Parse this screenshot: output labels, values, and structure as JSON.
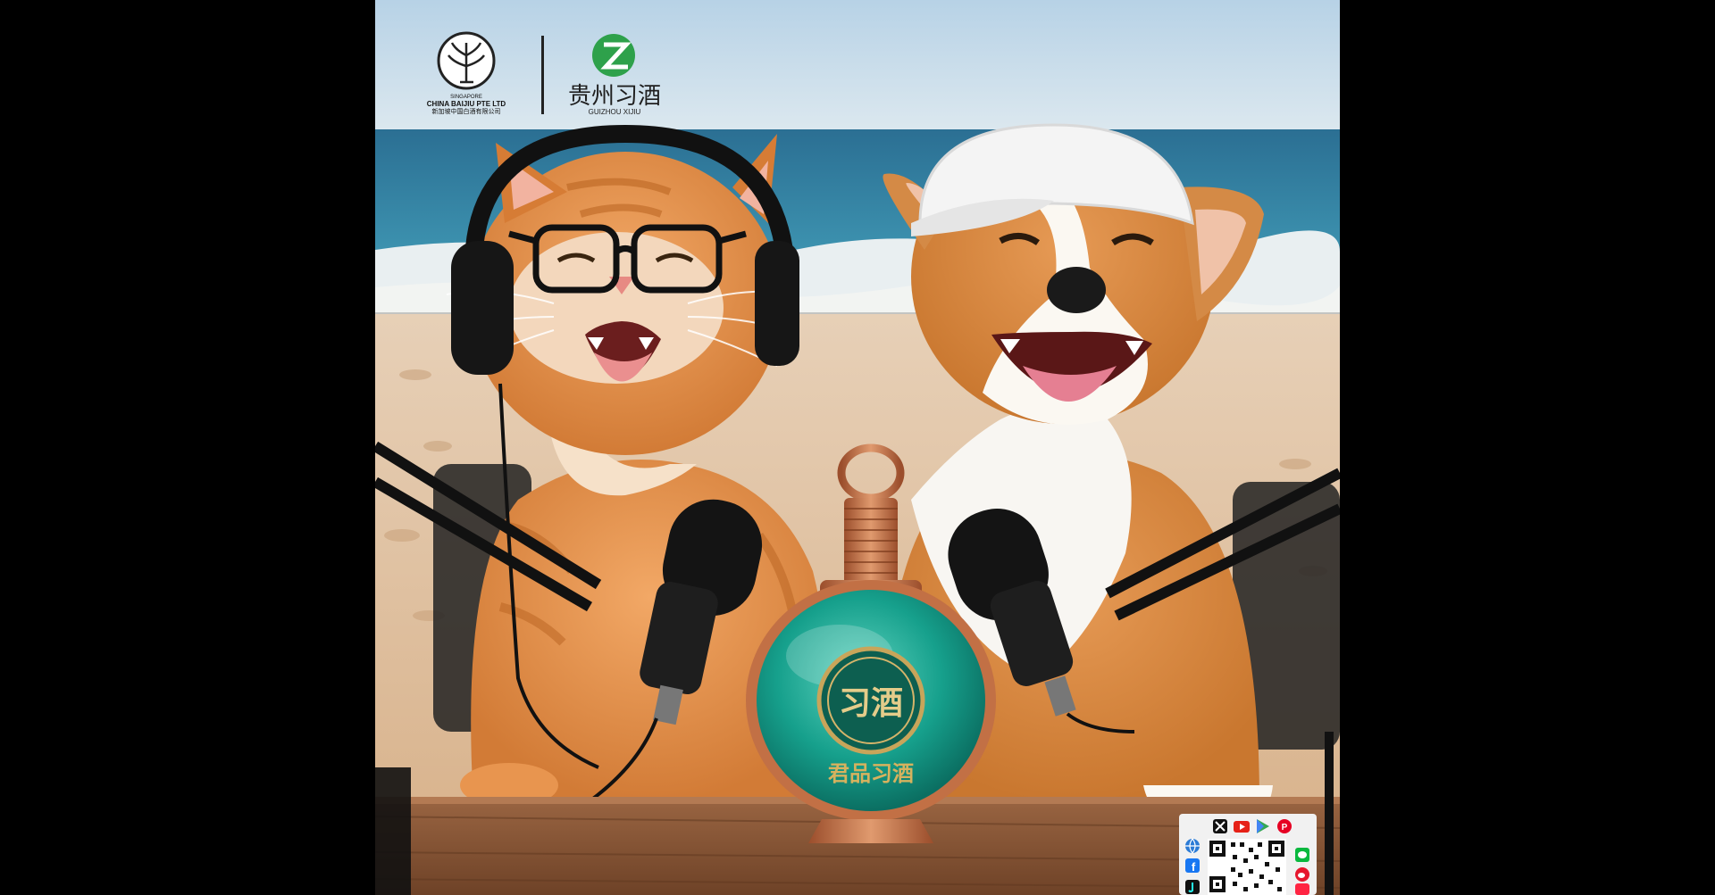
{
  "photo": {
    "subject": "",
    "colors": {
      "letterbox": "#000000",
      "sky_top": "#b9d3e6",
      "sky_bottom": "#d9e6ee",
      "sea": "#2f7fa3",
      "surf": "#e8eef0",
      "sand": "#e9cfb0",
      "table": "#8a5a3a",
      "cat_fur": "#e58f48",
      "dog_fur": "#d98a45",
      "bottle_green": "#1fa894",
      "bottle_copper": "#c9784e",
      "mic_black": "#1a1a1a"
    }
  },
  "logos": {
    "left_brand": {
      "icon": "baijiu-tree-emblem-icon",
      "line1": "SINGAPORE",
      "line2": "CHINA BAIJIU PTE LTD",
      "line3": "新加坡中国白酒有限公司"
    },
    "right_brand": {
      "icon": "xijiu-green-z-icon",
      "name_cn": "贵州习酒",
      "name_en": "GUIZHOU XIJIU"
    }
  },
  "bottle_label": {
    "emblem": "习酒",
    "name": "君品习酒"
  },
  "social_badge": {
    "icons": [
      "x-icon",
      "youtube-icon",
      "google-play-icon",
      "pinterest-icon",
      "facebook-icon",
      "wechat-icon",
      "weibo-icon"
    ]
  }
}
